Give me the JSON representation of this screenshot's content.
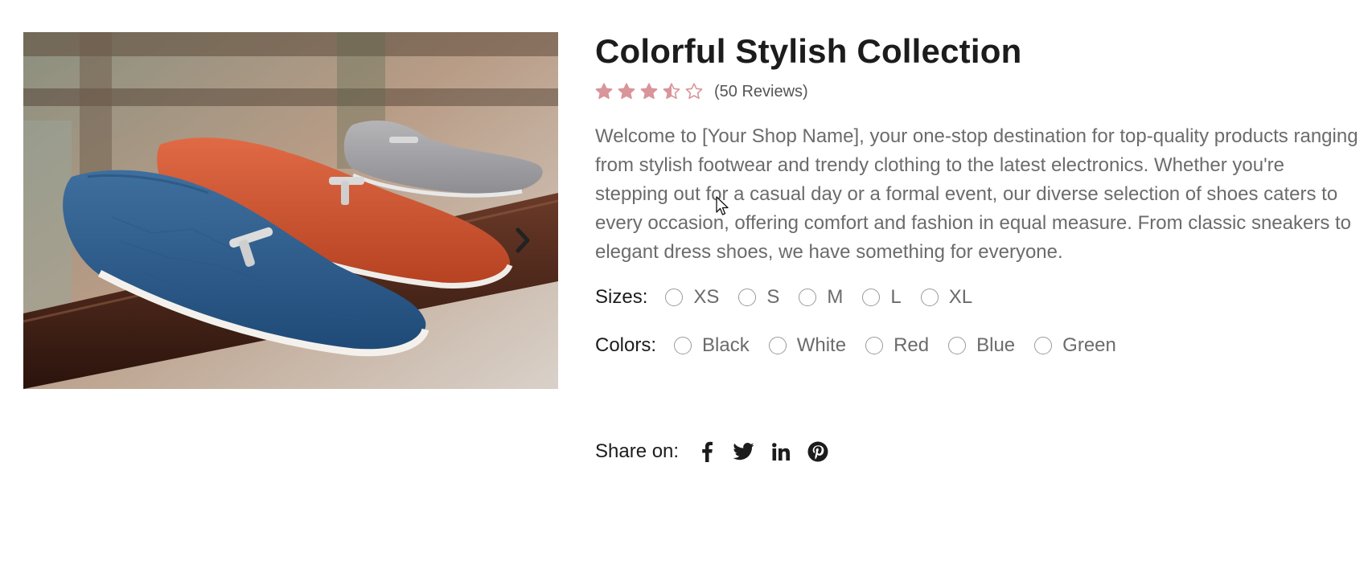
{
  "product": {
    "title": "Colorful Stylish Collection",
    "rating": 3.5,
    "rating_max": 5,
    "reviews_label": "(50 Reviews)",
    "description": "Welcome to [Your Shop Name], your one-stop destination for top-quality products ranging from stylish footwear and trendy clothing to the latest electronics. Whether you're stepping out for a casual day or a formal event, our diverse selection of shoes caters to every occasion, offering comfort and fashion in equal measure. From classic sneakers to elegant dress shoes, we have something for everyone."
  },
  "sizes": {
    "label": "Sizes:",
    "options": [
      "XS",
      "S",
      "M",
      "L",
      "XL"
    ]
  },
  "colors": {
    "label": "Colors:",
    "options": [
      "Black",
      "White",
      "Red",
      "Blue",
      "Green"
    ]
  },
  "share": {
    "label": "Share on:",
    "networks": [
      "facebook-icon",
      "twitter-icon",
      "linkedin-icon",
      "pinterest-icon"
    ]
  },
  "theme": {
    "star_color": "#d9959a",
    "text_dark": "#1c1c1c",
    "text_muted": "#6b6b6b"
  }
}
